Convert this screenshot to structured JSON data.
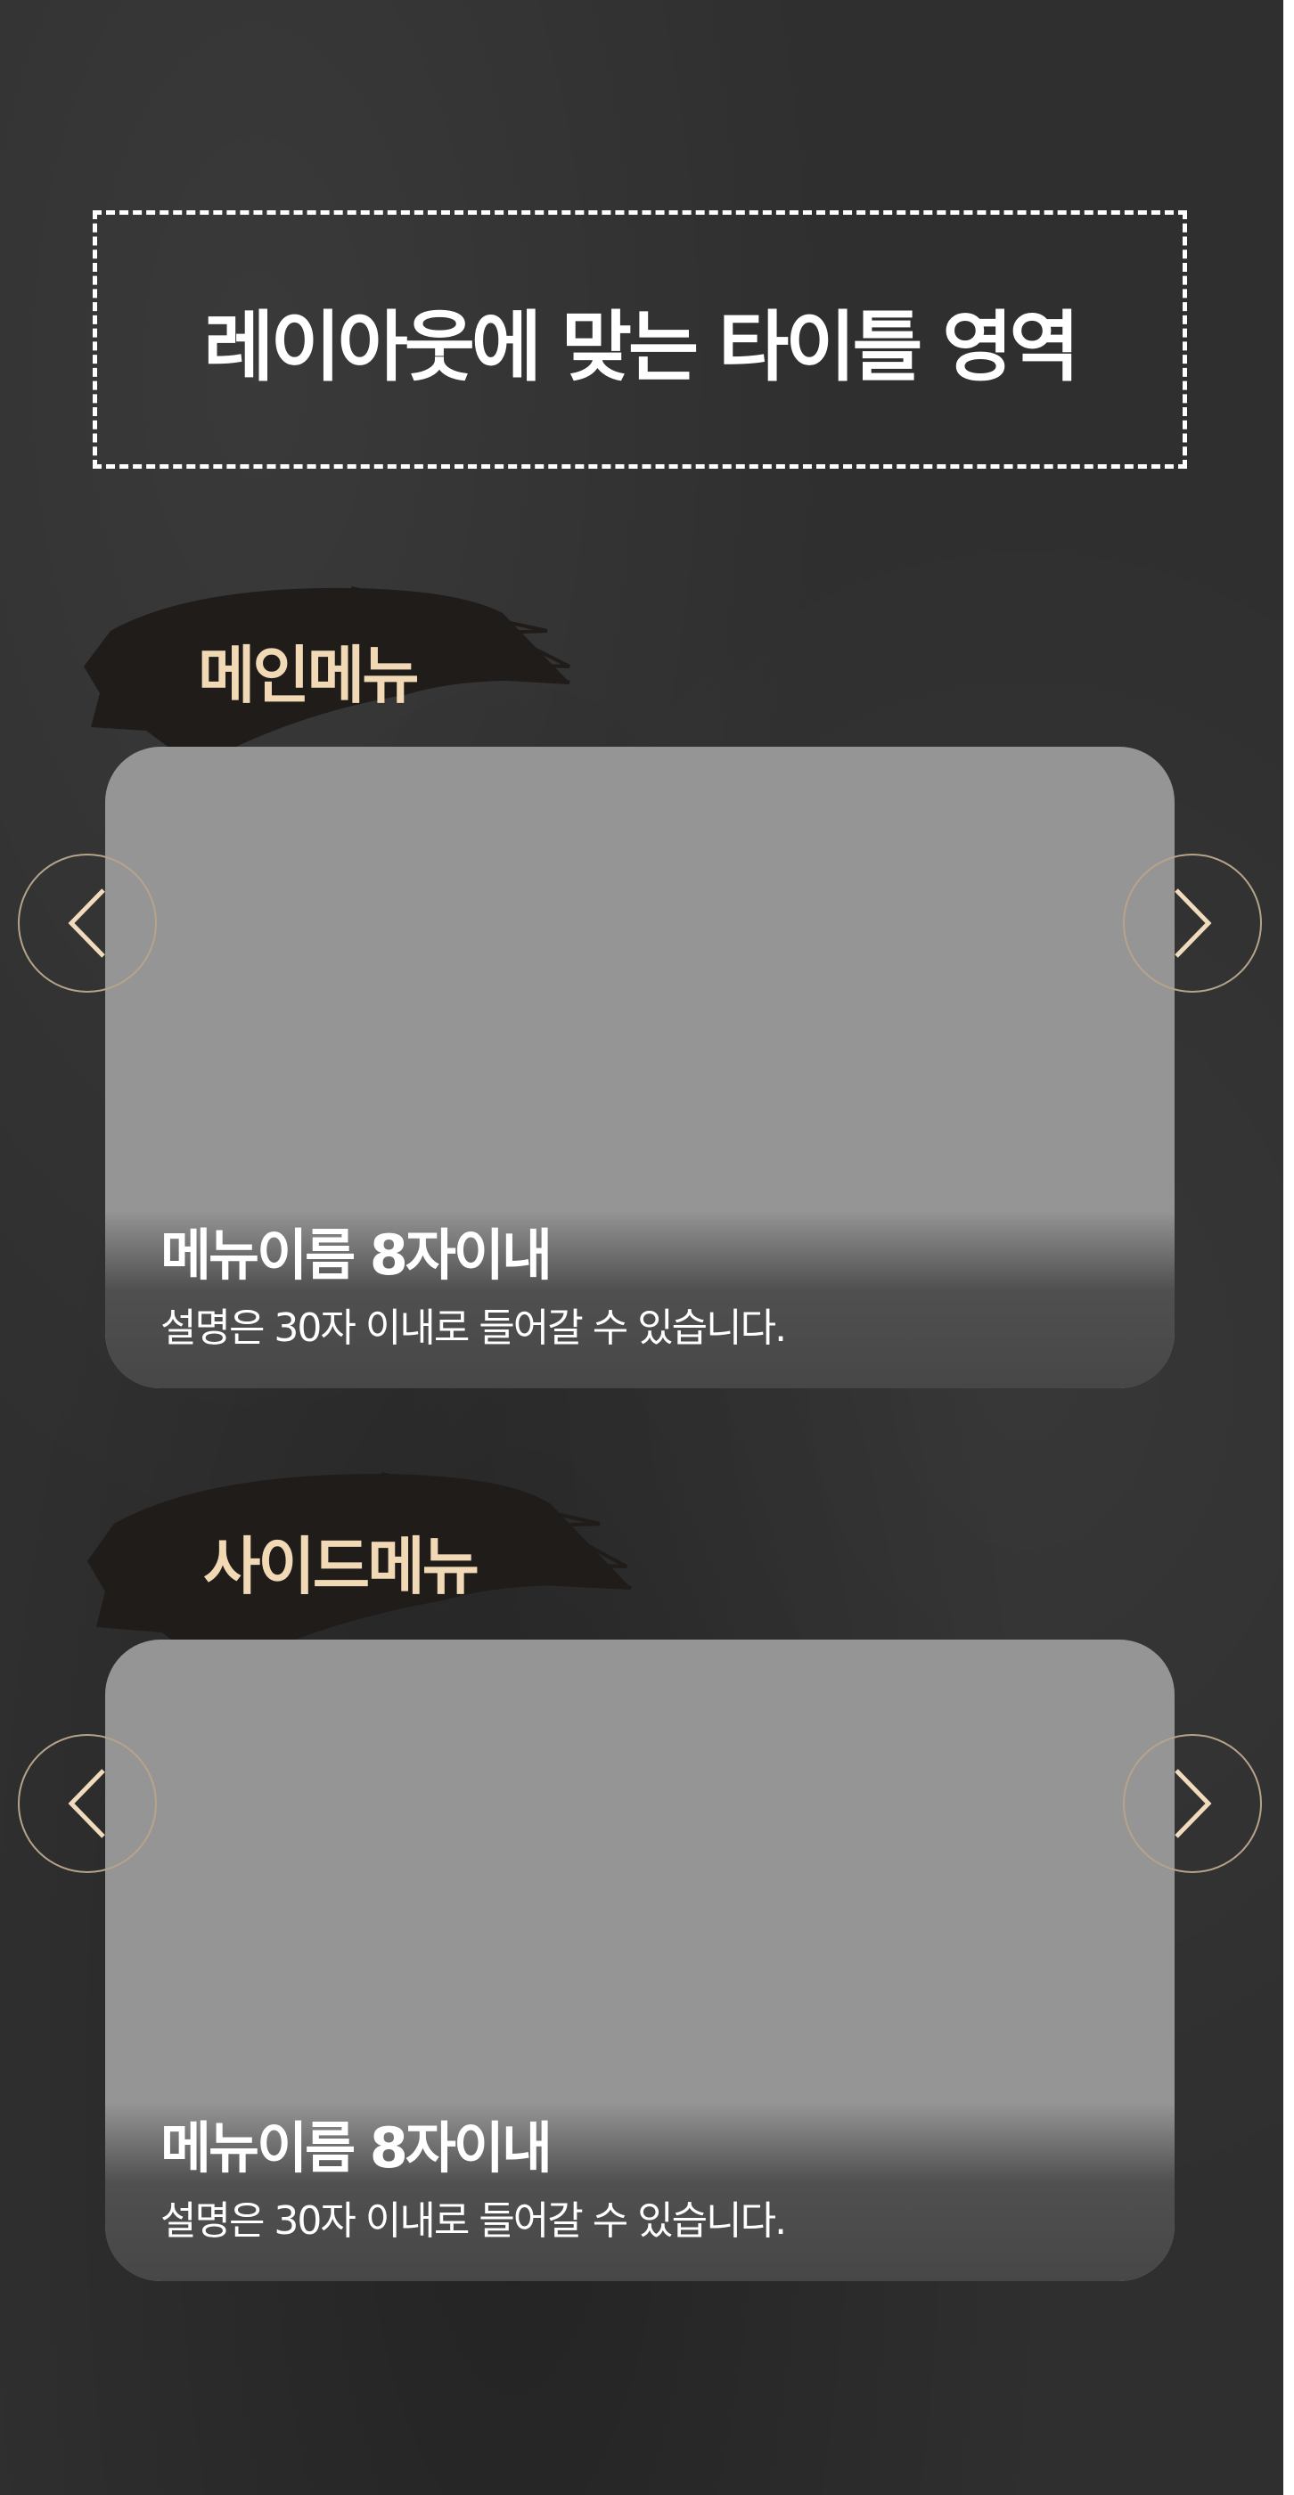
{
  "page": {
    "title": "레이아웃에 맞는 타이틀 영역"
  },
  "colors": {
    "background": "#2f2f2f",
    "accent_label": "#f2d9b5",
    "card": "#959595",
    "arrow": "#f0dcbc"
  },
  "sections": [
    {
      "label": "메인메뉴",
      "card": {
        "name": "메뉴이름 8자이내",
        "description": "설명은 30자 이내로 들어갈 수 있습니다."
      },
      "prev_icon": "chevron-left-icon",
      "next_icon": "chevron-right-icon"
    },
    {
      "label": "사이드메뉴",
      "card": {
        "name": "메뉴이름 8자이내",
        "description": "설명은 30자 이내로 들어갈 수 있습니다."
      },
      "prev_icon": "chevron-left-icon",
      "next_icon": "chevron-right-icon"
    }
  ]
}
